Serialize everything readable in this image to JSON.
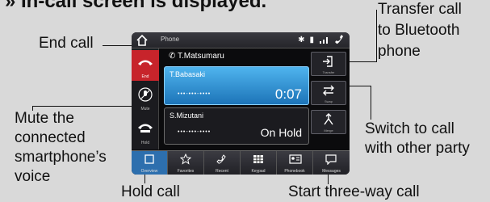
{
  "heading": "» In-call screen is displayed.",
  "callouts": {
    "end_call": "End call",
    "mute_1": "Mute the",
    "mute_2": "connected",
    "mute_3": "smartphone’s",
    "mute_4": "voice",
    "hold_call": "Hold call",
    "transfer_1": "Transfer call",
    "transfer_2": "to Bluetooth",
    "transfer_3": "phone",
    "switch_1": "Switch to call",
    "switch_2": "with other party",
    "three_way": "Start three-way call"
  },
  "screen": {
    "app_title": "Phone",
    "status_icons": [
      "bluetooth-icon",
      "battery-icon",
      "signal-icon",
      "phone-icon"
    ],
    "caller_header": "T.Matsumaru",
    "left_buttons": [
      {
        "label": "End",
        "icon": "end-call-icon"
      },
      {
        "label": "Mute",
        "icon": "mute-mic-icon"
      },
      {
        "label": "Hold",
        "icon": "hold-phone-icon"
      }
    ],
    "active_call": {
      "name": "T.Babasaki",
      "number": "•••-•••-••••",
      "timer": "0:07"
    },
    "held_call": {
      "name": "S.Mizutani",
      "number": "•••-•••-••••",
      "status": "On Hold"
    },
    "right_buttons": [
      {
        "label": "Transfer",
        "icon": "transfer-icon"
      },
      {
        "label": "Swap",
        "icon": "swap-icon"
      },
      {
        "label": "Merge",
        "icon": "merge-icon"
      }
    ],
    "nav": [
      {
        "label": "Overview",
        "icon": "overview-icon",
        "selected": true
      },
      {
        "label": "Favorites",
        "icon": "star-icon"
      },
      {
        "label": "Recent",
        "icon": "recent-call-icon"
      },
      {
        "label": "Keypad",
        "icon": "keypad-icon"
      },
      {
        "label": "Phonebook",
        "icon": "phonebook-icon"
      },
      {
        "label": "Messages",
        "icon": "message-icon"
      }
    ]
  },
  "colors": {
    "background": "#d9d9d9",
    "end_button": "#c7242b",
    "active_card": "#1d74b8",
    "nav_selected": "#2d6fae"
  }
}
